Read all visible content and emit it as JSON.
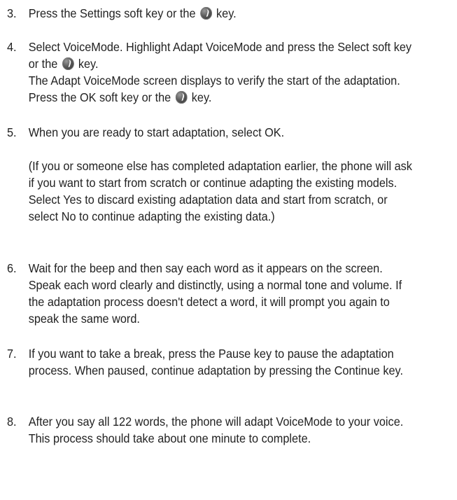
{
  "steps": [
    {
      "num": "3.",
      "text_a": "Press the Settings soft key or the",
      "text_b": "key.",
      "key_icon": "ok-key-icon"
    },
    {
      "num": "4.",
      "text_a": "Select VoiceMode. Highlight Adapt VoiceMode and press the Select soft key or the",
      "text_b": "key.",
      "text_c": "The Adapt VoiceMode screen displays to verify the start of the adaptation. Press the OK soft key or the",
      "text_d": "key."
    },
    {
      "num": "5.",
      "text": "When you are ready to start adaptation, select OK.",
      "note": "(If you or someone else has completed adaptation earlier, the phone will ask if you want to start from scratch or continue adapting the existing models. Select Yes to discard existing adaptation data and start from scratch, or select No to continue adapting the existing data.)"
    },
    {
      "num": "6.",
      "text": "Wait for the beep and then say each word as it appears on the screen. Speak each word clearly and distinctly, using a normal tone and volume. If the adaptation process doesn't detect a word, it will prompt you again to speak the same word."
    },
    {
      "num": "7.",
      "text": "If you want to take a break, press the Pause key to pause the adaptation process. When paused, continue adaptation by pressing the Continue key."
    },
    {
      "num": "8.",
      "text": "After you say all 122 words, the phone will adapt VoiceMode to your voice. This process should take about one minute to complete."
    }
  ]
}
